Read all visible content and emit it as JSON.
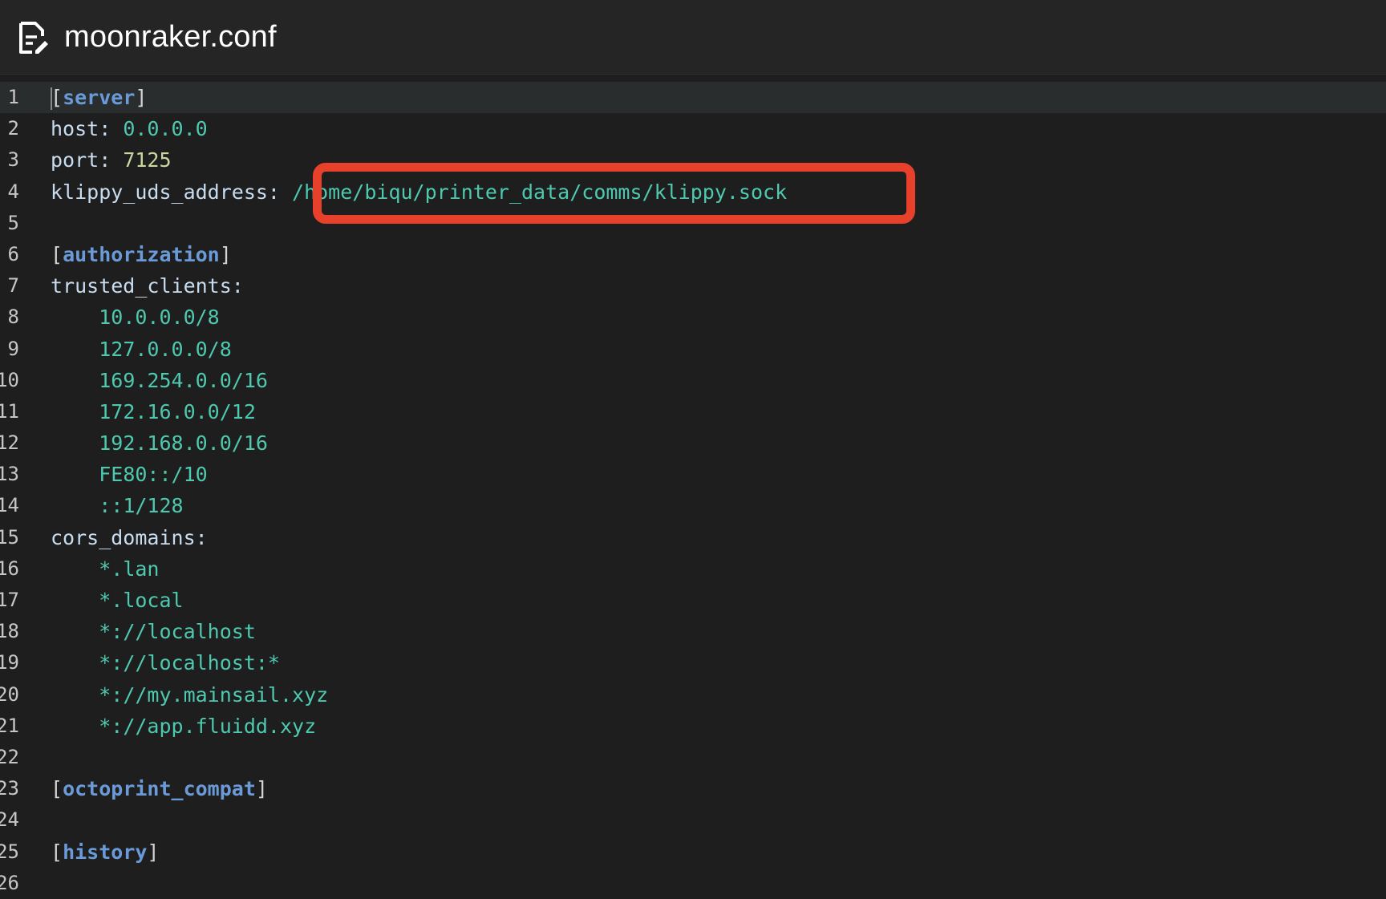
{
  "header": {
    "filename": "moonraker.conf",
    "icon": "file-edit-icon"
  },
  "editor": {
    "lines": [
      {
        "n": "1",
        "type": "section",
        "text": "server"
      },
      {
        "n": "2",
        "type": "kv",
        "key": "host: ",
        "value": "0.0.0.0",
        "vclass": "val"
      },
      {
        "n": "3",
        "type": "kv",
        "key": "port: ",
        "value": "7125",
        "vclass": "num"
      },
      {
        "n": "4",
        "type": "kv",
        "key": "klippy_uds_address: ",
        "value": "/home/biqu/printer_data/comms/klippy.sock",
        "vclass": "val"
      },
      {
        "n": "5",
        "type": "blank"
      },
      {
        "n": "6",
        "type": "section",
        "text": "authorization"
      },
      {
        "n": "7",
        "type": "key",
        "key": "trusted_clients:"
      },
      {
        "n": "8",
        "type": "item",
        "value": "10.0.0.0/8"
      },
      {
        "n": "9",
        "type": "item",
        "value": "127.0.0.0/8"
      },
      {
        "n": "10",
        "type": "item",
        "value": "169.254.0.0/16"
      },
      {
        "n": "11",
        "type": "item",
        "value": "172.16.0.0/12"
      },
      {
        "n": "12",
        "type": "item",
        "value": "192.168.0.0/16"
      },
      {
        "n": "13",
        "type": "item",
        "value": "FE80::/10"
      },
      {
        "n": "14",
        "type": "item",
        "value": "::1/128"
      },
      {
        "n": "15",
        "type": "key",
        "key": "cors_domains:"
      },
      {
        "n": "16",
        "type": "item",
        "value": "*.lan"
      },
      {
        "n": "17",
        "type": "item",
        "value": "*.local"
      },
      {
        "n": "18",
        "type": "item",
        "value": "*://localhost"
      },
      {
        "n": "19",
        "type": "item",
        "value": "*://localhost:*"
      },
      {
        "n": "20",
        "type": "item",
        "value": "*://my.mainsail.xyz"
      },
      {
        "n": "21",
        "type": "item",
        "value": "*://app.fluidd.xyz"
      },
      {
        "n": "22",
        "type": "blank"
      },
      {
        "n": "23",
        "type": "section",
        "text": "octoprint_compat"
      },
      {
        "n": "24",
        "type": "blank"
      },
      {
        "n": "25",
        "type": "section",
        "text": "history"
      },
      {
        "n": "26",
        "type": "blank"
      }
    ]
  },
  "colors": {
    "highlight": "#e8412b",
    "section": "#6a9bd8",
    "value": "#4ec9b0"
  }
}
